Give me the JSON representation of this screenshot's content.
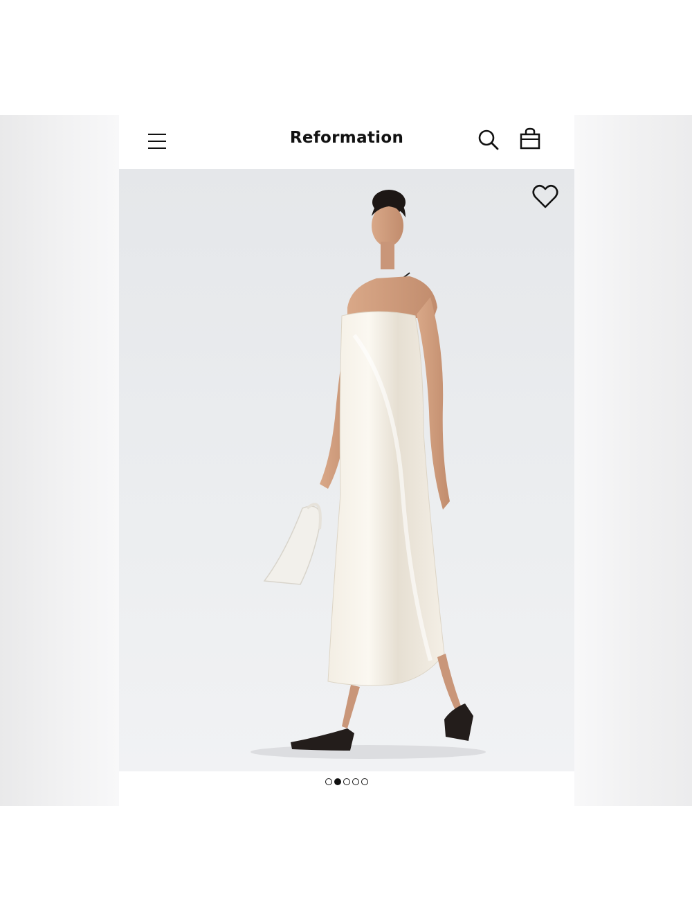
{
  "header": {
    "brand": "Reformation",
    "menu_icon": "hamburger-menu-icon",
    "search_icon": "search-icon",
    "bag_icon": "shopping-bag-icon"
  },
  "product_image": {
    "favorite_icon": "heart-outline-icon",
    "background_color": "#e8eaec"
  },
  "carousel": {
    "total_slides": 5,
    "active_index": 1
  }
}
